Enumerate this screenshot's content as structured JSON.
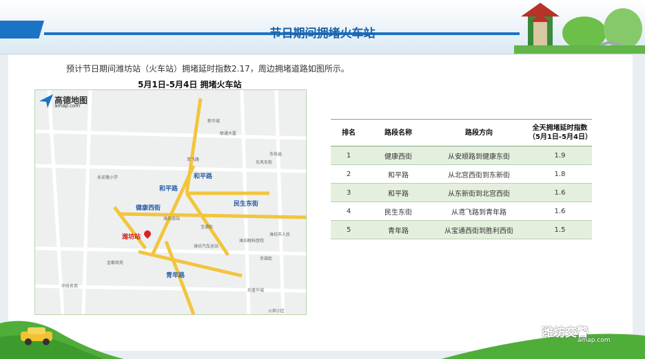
{
  "slide": {
    "title": "节日期间拥堵火车站",
    "intro": "预计节日期间潍坊站（火车站）拥堵延时指数2.17，周边拥堵道路如图所示。",
    "map_title": "5月1日-5月4日 拥堵火车站"
  },
  "map": {
    "logo_main": "高德地图",
    "logo_sub": "amap.com",
    "station_label": "潍坊站",
    "road_labels": [
      "和平路",
      "和平路",
      "健康西街",
      "民生东街",
      "青年路"
    ],
    "places": [
      "新华城",
      "联通大厦",
      "东岳庙",
      "潍坊市人民",
      "潍坊眼科医院",
      "潍坊汽车总站",
      "潍坊南站",
      "金都商苑",
      "华府名苑",
      "坊盛华城",
      "永安路小学",
      "幸福街",
      "宝通街",
      "鸢飞路",
      "东风东街",
      "火炬小区"
    ]
  },
  "table": {
    "headers": [
      "排名",
      "路段名称",
      "路段方向",
      "全天拥堵延时指数\n（5月1日-5月4日）"
    ],
    "rows": [
      [
        "1",
        "健康西街",
        "从安顺路到健康东街",
        "1.9"
      ],
      [
        "2",
        "和平路",
        "从北宫西街到东新街",
        "1.8"
      ],
      [
        "3",
        "和平路",
        "从东新街到北宫西街",
        "1.6"
      ],
      [
        "4",
        "民生东街",
        "从鸢飞路到青年路",
        "1.6"
      ],
      [
        "5",
        "青年路",
        "从宝通西街到胜利西街",
        "1.5"
      ]
    ]
  },
  "watermark": {
    "main": "潍坊交警",
    "sub": "amap.com"
  },
  "colors": {
    "accent": "#1a73c4",
    "road": "#f2c53d",
    "table_alt": "#e4f0dd"
  }
}
